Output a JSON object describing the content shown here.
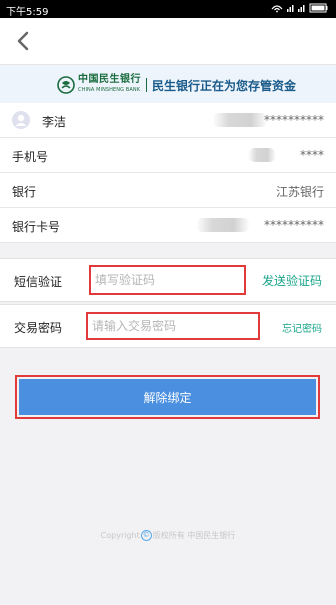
{
  "status_bar": {
    "time": "下午5:59",
    "signal_icons": "wifi-icon signal-icon signal-icon battery-icon"
  },
  "navbar": {
    "back_icon": "chevron-left-icon"
  },
  "banner": {
    "bank_name_cn": "中国民生银行",
    "bank_name_en": "CHINA MINSHENG BANK",
    "slogan": "民生银行正在为您存管资金",
    "brand_color": "#1a6b3d"
  },
  "account": {
    "name": "李洁",
    "name_masked": "**********",
    "phone_label": "手机号",
    "phone_value": "****",
    "bank_label": "银行",
    "bank_value": "江苏银行",
    "card_label": "银行卡号",
    "card_value": "**********"
  },
  "sms": {
    "label": "短信验证",
    "placeholder": "填写验证码",
    "send_link": "发送验证码"
  },
  "trade_password": {
    "label": "交易密码",
    "placeholder": "请输入交易密码",
    "forgot_link": "忘记密码"
  },
  "unbind": {
    "label": "解除绑定",
    "color": "#4a8fe0"
  },
  "footer": {
    "prefix": "Copyright",
    "symbol": "©",
    "text": "版权所有 中国民生银行"
  }
}
